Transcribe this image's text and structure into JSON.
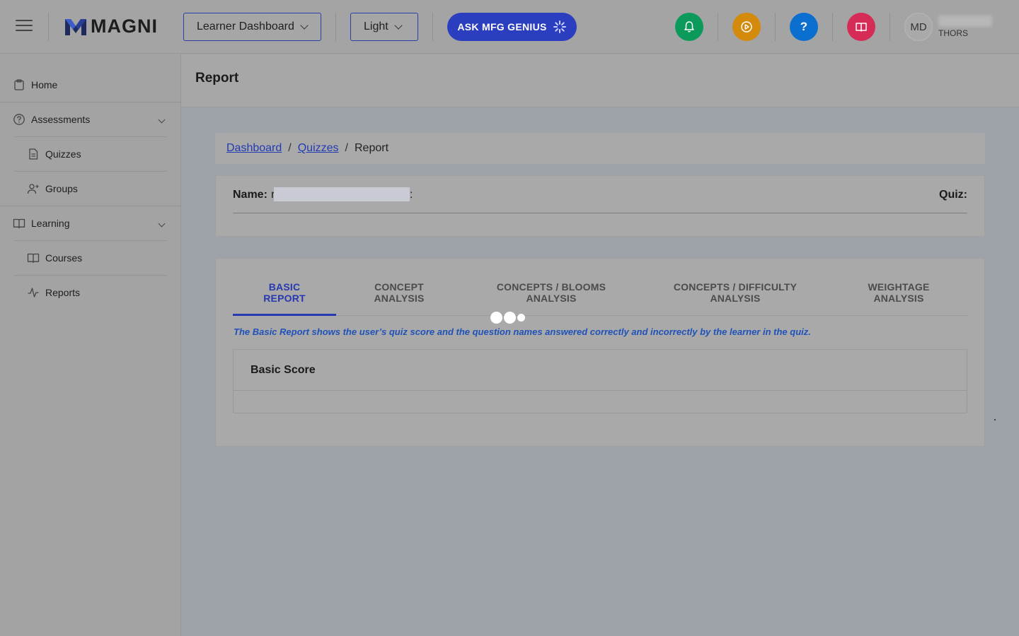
{
  "header": {
    "logo_text": "MAGNI",
    "dashboard_select": "Learner Dashboard",
    "theme_select": "Light",
    "ask_button": "ASK MFG GENIUS",
    "notify_color": "#0c9a5b",
    "play_color": "#d48a0b",
    "help_color": "#0b6fd0",
    "book_color": "#d72b57",
    "help_glyph": "?",
    "avatar_initials": "MD",
    "user_org": "THORS"
  },
  "sidebar": {
    "items": [
      {
        "label": "Home",
        "icon": "clipboard-icon"
      },
      {
        "label": "Assessments",
        "icon": "question-circle-icon"
      },
      {
        "label": "Quizzes",
        "icon": "document-icon"
      },
      {
        "label": "Groups",
        "icon": "user-add-icon"
      },
      {
        "label": "Learning",
        "icon": "book-icon"
      },
      {
        "label": "Courses",
        "icon": "book-icon"
      },
      {
        "label": "Reports",
        "icon": "activity-icon"
      }
    ]
  },
  "page": {
    "title": "Report",
    "breadcrumb": [
      "Dashboard",
      "Quizzes",
      "Report"
    ],
    "name_label": "Name:",
    "name_value_prefix": "r",
    "name_value_suffix": ":",
    "quiz_label": "Quiz:"
  },
  "tabs": [
    {
      "line1": "BASIC",
      "line2": "REPORT",
      "active": true
    },
    {
      "line1": "CONCEPT",
      "line2": "ANALYSIS",
      "active": false
    },
    {
      "line1": "CONCEPTS / BLOOMS",
      "line2": "ANALYSIS",
      "active": false
    },
    {
      "line1": "CONCEPTS / DIFFICULTY",
      "line2": "ANALYSIS",
      "active": false
    },
    {
      "line1": "WEIGHTAGE",
      "line2": "ANALYSIS",
      "active": false
    }
  ],
  "report": {
    "description": "The Basic Report shows the user’s quiz score and the question names answered correctly and incorrectly by the learner in the quiz.",
    "score_heading": "Basic Score"
  }
}
